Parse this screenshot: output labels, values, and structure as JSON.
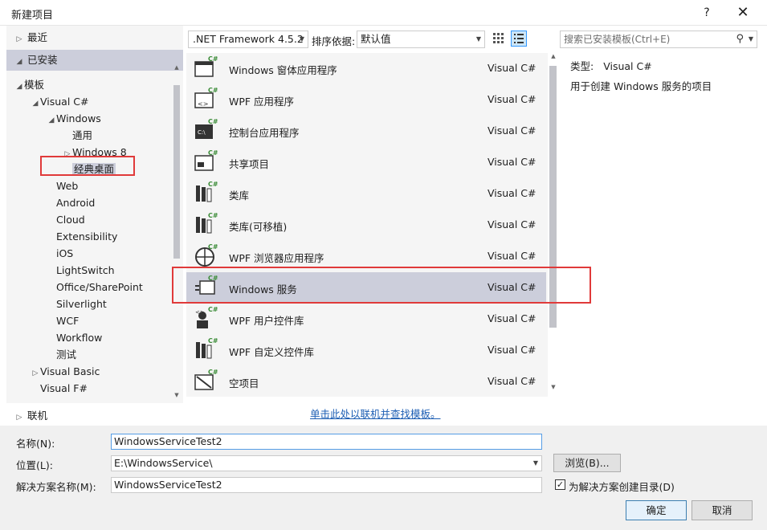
{
  "window": {
    "title": "新建项目",
    "help": "?",
    "close": "✕"
  },
  "tree": {
    "recent": "最近",
    "installed": "已安装",
    "items": [
      {
        "label": "模板",
        "arrow": "◢"
      },
      {
        "label": "Visual C#",
        "arrow": "◢"
      },
      {
        "label": "Windows",
        "arrow": "◢"
      },
      {
        "label": "通用",
        "arrow": ""
      },
      {
        "label": "Windows 8",
        "arrow": "▷"
      },
      {
        "label": "经典桌面",
        "arrow": ""
      },
      {
        "label": "Web",
        "arrow": ""
      },
      {
        "label": "Android",
        "arrow": ""
      },
      {
        "label": "Cloud",
        "arrow": ""
      },
      {
        "label": "Extensibility",
        "arrow": ""
      },
      {
        "label": "iOS",
        "arrow": ""
      },
      {
        "label": "LightSwitch",
        "arrow": ""
      },
      {
        "label": "Office/SharePoint",
        "arrow": ""
      },
      {
        "label": "Silverlight",
        "arrow": ""
      },
      {
        "label": "WCF",
        "arrow": ""
      },
      {
        "label": "Workflow",
        "arrow": ""
      },
      {
        "label": "测试",
        "arrow": ""
      },
      {
        "label": "Visual Basic",
        "arrow": "▷"
      },
      {
        "label": "Visual F#",
        "arrow": ""
      }
    ],
    "online": "联机"
  },
  "toolbar": {
    "framework": ".NET Framework 4.5.2",
    "sort_label": "排序依据:",
    "sort_value": "默认值",
    "search_placeholder": "搜索已安装模板(Ctrl+E)"
  },
  "templates": [
    {
      "name": "Windows 窗体应用程序",
      "lang": "Visual C#",
      "icon": "winforms-icon"
    },
    {
      "name": "WPF 应用程序",
      "lang": "Visual C#",
      "icon": "wpf-app-icon"
    },
    {
      "name": "控制台应用程序",
      "lang": "Visual C#",
      "icon": "console-icon"
    },
    {
      "name": "共享项目",
      "lang": "Visual C#",
      "icon": "shared-project-icon"
    },
    {
      "name": "类库",
      "lang": "Visual C#",
      "icon": "class-library-icon"
    },
    {
      "name": "类库(可移植)",
      "lang": "Visual C#",
      "icon": "portable-library-icon"
    },
    {
      "name": "WPF 浏览器应用程序",
      "lang": "Visual C#",
      "icon": "wpf-browser-icon"
    },
    {
      "name": "Windows 服务",
      "lang": "Visual C#",
      "icon": "windows-service-icon",
      "selected": true
    },
    {
      "name": "WPF 用户控件库",
      "lang": "Visual C#",
      "icon": "wpf-user-control-icon"
    },
    {
      "name": "WPF 自定义控件库",
      "lang": "Visual C#",
      "icon": "wpf-custom-control-icon"
    },
    {
      "name": "空项目",
      "lang": "Visual C#",
      "icon": "empty-project-icon"
    }
  ],
  "description": {
    "type_label": "类型:",
    "type_value": "Visual C#",
    "text": "用于创建 Windows 服务的项目"
  },
  "online_link": "单击此处以联机并查找模板。",
  "form": {
    "name_label": "名称(N):",
    "name_value": "WindowsServiceTest2",
    "location_label": "位置(L):",
    "location_value": "E:\\WindowsService\\",
    "solution_label": "解决方案名称(M):",
    "solution_value": "WindowsServiceTest2",
    "browse": "浏览(B)...",
    "create_dir_label": "为解决方案创建目录(D)",
    "create_dir_checked": true,
    "ok": "确定",
    "cancel": "取消"
  },
  "colors": {
    "selection": "#cccedb",
    "highlight_box": "#e03a3a",
    "link": "#1e5fb4"
  }
}
